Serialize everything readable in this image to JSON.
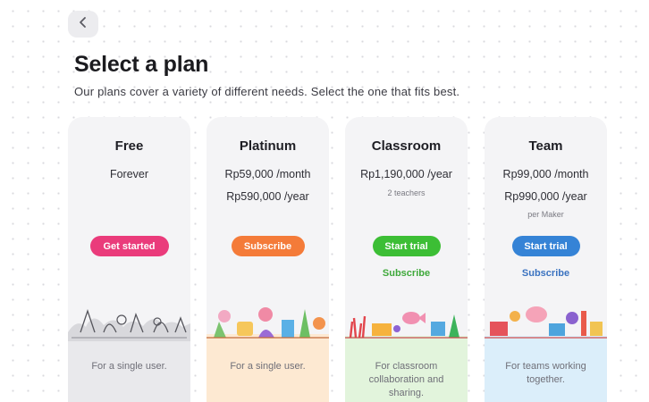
{
  "header": {
    "title": "Select a plan",
    "subtitle": "Our plans cover a variety of different needs. Select the one that fits best."
  },
  "plans": [
    {
      "name": "Free",
      "price1": "Forever",
      "price2": "",
      "note": "",
      "cta": "Get started",
      "cta_color": "#ea3b7b",
      "subscribe": "",
      "description": "For a single user.",
      "bottom_color": "#e9e9ec"
    },
    {
      "name": "Platinum",
      "price1": "Rp59,000 /month",
      "price2": "Rp590,000 /year",
      "note": "",
      "cta": "Subscribe",
      "cta_color": "#f47b39",
      "subscribe": "",
      "description": "For a single user.",
      "bottom_color": "#fde9d2"
    },
    {
      "name": "Classroom",
      "price1": "Rp1,190,000 /year",
      "price2": "",
      "note": "2 teachers",
      "cta": "Start trial",
      "cta_color": "#3cbe35",
      "subscribe": "Subscribe",
      "subscribe_color": "#3ea83a",
      "description": "For classroom collaboration and sharing.",
      "bottom_color": "#e2f4dc"
    },
    {
      "name": "Team",
      "price1": "Rp99,000 /month",
      "price2": "Rp990,000 /year",
      "note": "per Maker",
      "cta": "Start trial",
      "cta_color": "#3583d6",
      "subscribe": "Subscribe",
      "subscribe_color": "#3a72c0",
      "description": "For teams working together.",
      "bottom_color": "#dbeefa"
    }
  ],
  "icons": {
    "back": "chevron-left-icon"
  }
}
